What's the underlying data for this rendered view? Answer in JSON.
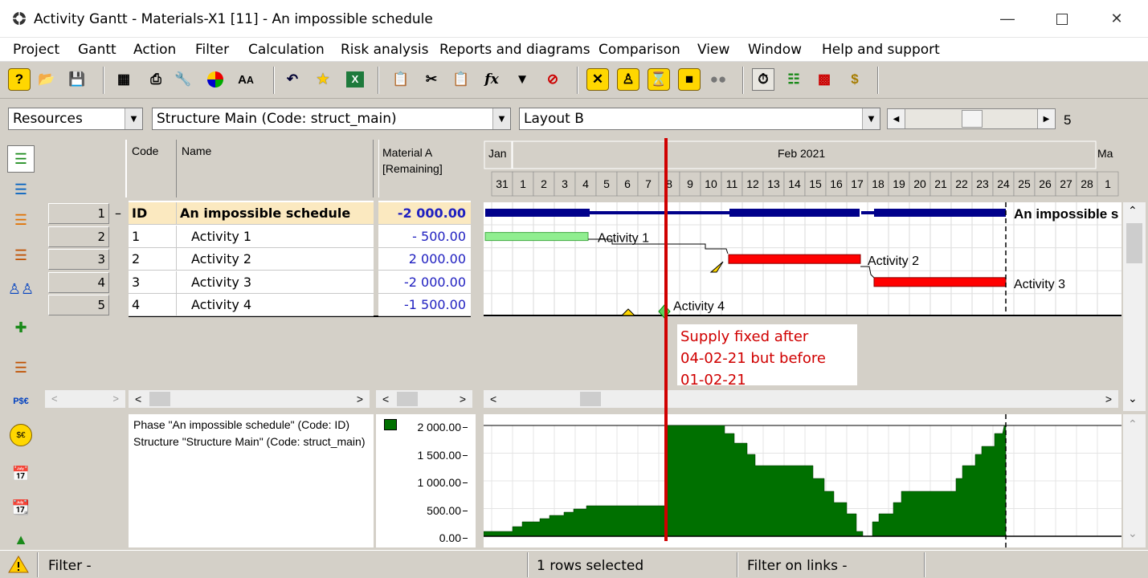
{
  "window": {
    "title": "Activity Gantt - Materials-X1 [11] - An impossible schedule"
  },
  "menu": [
    "Project",
    "Gantt",
    "Action",
    "Filter",
    "Calculation",
    "Risk analysis",
    "Reports and diagrams",
    "Comparison",
    "View",
    "Window",
    "Help and support"
  ],
  "combos": {
    "view": "Resources",
    "structure": "Structure Main (Code: struct_main)",
    "layout": "Layout B",
    "slider_value": "5"
  },
  "table": {
    "headers": {
      "code": "Code",
      "name": "Name",
      "material": "Material A\n[Remaining]"
    },
    "rows": [
      {
        "num": "1",
        "expander": "–",
        "code": "ID",
        "name": "An impossible schedule",
        "value": "-2 000.00",
        "bold": true
      },
      {
        "num": "2",
        "expander": "",
        "code": "1",
        "name": "Activity 1",
        "value": "- 500.00"
      },
      {
        "num": "3",
        "expander": "",
        "code": "2",
        "name": "Activity 2",
        "value": "2 000.00"
      },
      {
        "num": "4",
        "expander": "",
        "code": "3",
        "name": "Activity 3",
        "value": "-2 000.00"
      },
      {
        "num": "5",
        "expander": "",
        "code": "4",
        "name": "Activity 4",
        "value": "-1 500.00"
      }
    ]
  },
  "timeline": {
    "months": [
      "Jan",
      "Feb 2021",
      "Ma"
    ],
    "days": [
      "31",
      "1",
      "2",
      "3",
      "4",
      "5",
      "6",
      "7",
      "8",
      "9",
      "10",
      "11",
      "12",
      "13",
      "14",
      "15",
      "16",
      "17",
      "18",
      "19",
      "20",
      "21",
      "22",
      "23",
      "24",
      "25",
      "26",
      "27",
      "28",
      "1"
    ]
  },
  "gantt_labels": [
    "An impossible s",
    "Activity 1",
    "Activity 2",
    "Activity 3",
    "Activity 4"
  ],
  "annotation": {
    "line1": "Supply fixed after",
    "line2": "04-02-21 but before",
    "line3": "01-02-21",
    "color": "#d00000"
  },
  "info": {
    "text": "Phase \"An impossible schedule\" (Code: ID) Structure \"Structure Main\" (Code: struct_main)"
  },
  "chart_axis": [
    "2 000.00",
    "1 500.00",
    "1 000.00",
    "500.00",
    "0.00"
  ],
  "status": {
    "filter": "Filter -",
    "selected": "1 rows selected",
    "links": "Filter on links -"
  },
  "colors": {
    "summary_bar": "#00008b",
    "activity1": "#90ee90",
    "activity_red": "#ff0000",
    "histogram": "#007000"
  }
}
